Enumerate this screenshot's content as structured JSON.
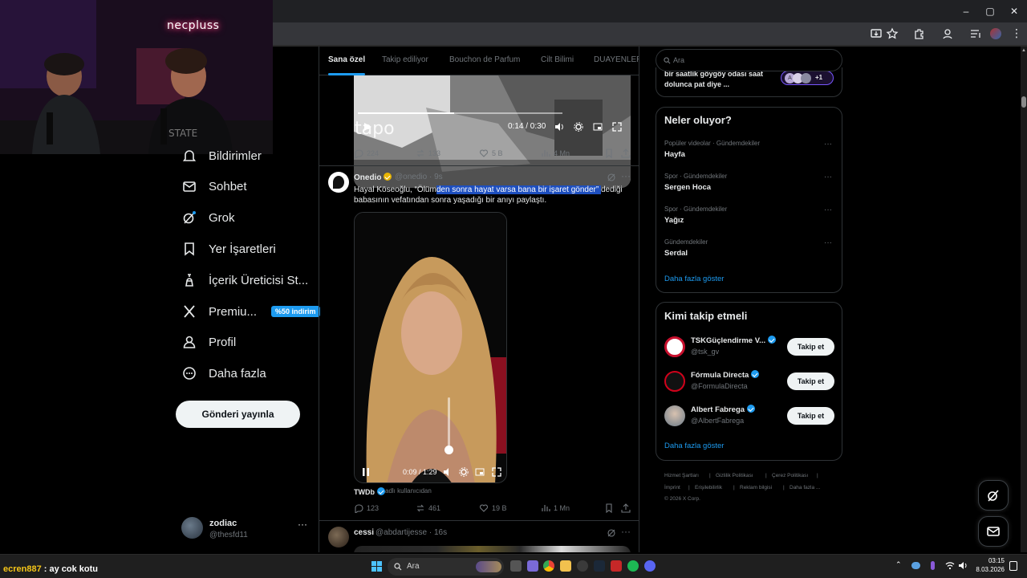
{
  "webcam": {
    "logo": "necpluss"
  },
  "sidebar": {
    "items": [
      {
        "label": "Bildirimler",
        "icon": "bell-icon"
      },
      {
        "label": "Sohbet",
        "icon": "mail-icon"
      },
      {
        "label": "Grok",
        "icon": "grok-icon"
      },
      {
        "label": "Yer İşaretleri",
        "icon": "bookmark-icon"
      },
      {
        "label": "İçerik Üreticisi St...",
        "icon": "creator-studio-icon"
      },
      {
        "label": "Premiu...",
        "icon": "x-logo-icon",
        "badge": "%50 indirim"
      },
      {
        "label": "Profil",
        "icon": "person-icon"
      },
      {
        "label": "Daha fazla",
        "icon": "more-circle-icon"
      }
    ],
    "post_button": "Gönderi yayınla",
    "account": {
      "name": "zodiac",
      "handle": "@thesfd11",
      "more": "···"
    }
  },
  "timeline": {
    "tabs": [
      "Sana özel",
      "Takip ediliyor",
      "Bouchon de Parfum",
      "Cilt Bilimi",
      "DUAYENLER"
    ],
    "post1": {
      "watermark": "tapo",
      "time": "0:14 / 0:30",
      "stats": {
        "replies": "224",
        "reposts": "133",
        "likes": "5 B",
        "views": "4 Mn"
      }
    },
    "post2": {
      "name": "Onedio",
      "handle": "@onedio · 9s",
      "text_pre": "Hayal Köseoğlu, “Ölüm",
      "text_hl": "den sonra hayat varsa bana bir işaret gönder” ",
      "text_post": "dediği babasının vefatından sonra yaşadığı bir anıyı paylaştı.",
      "video_time": "0:09 / 1:29",
      "source_name": "TWDb",
      "source_note": "adlı kullanıcıdan",
      "stats": {
        "replies": "123",
        "reposts": "461",
        "likes": "19 B",
        "views": "1 Mn"
      }
    },
    "post3": {
      "name": "cessi",
      "handle": "@abdartijesse · 16s"
    }
  },
  "right": {
    "search_placeholder": "Ara",
    "spaces": {
      "text": "bir saatlik göygöy odası saat dolunca pat diye ...",
      "extra": "+1"
    },
    "trends_title": "Neler oluyor?",
    "trends": [
      {
        "category": "Popüler videolar · Gündemdekiler",
        "name": "Hayfa"
      },
      {
        "category": "Spor · Gündemdekiler",
        "name": "Sergen Hoca"
      },
      {
        "category": "Spor · Gündemdekiler",
        "name": "Yağız"
      },
      {
        "category": "Gündemdekiler",
        "name": "Serdal"
      }
    ],
    "trends_more": "Daha fazla göster",
    "follow_title": "Kimi takip etmeli",
    "follow": [
      {
        "name": "TSKGüçlendirme V...",
        "handle": "@tsk_gv",
        "button": "Takip et",
        "color": "#c8102e"
      },
      {
        "name": "Fórmula Directa",
        "handle": "@FormulaDirecta",
        "button": "Takip et",
        "color": "#d0021b"
      },
      {
        "name": "Albert Fabrega",
        "handle": "@AlbertFabrega",
        "button": "Takip et",
        "color": "#8a9aa8"
      }
    ],
    "follow_more": "Daha fazla göster",
    "footer": {
      "line1": [
        "Hizmet Şartları",
        "Gizlilik Politikası",
        "Çerez Politikası"
      ],
      "line2": [
        "İmprint",
        "Erişilebilirlik",
        "Reklam bilgisi",
        "Daha fazla ..."
      ],
      "copyright": "© 2026 X Corp."
    }
  },
  "taskbar": {
    "chat_user": "ecren887",
    "chat_message": " : ay cok kotu",
    "search": "Ara",
    "time": "03:15",
    "date": "8.03.2026"
  }
}
